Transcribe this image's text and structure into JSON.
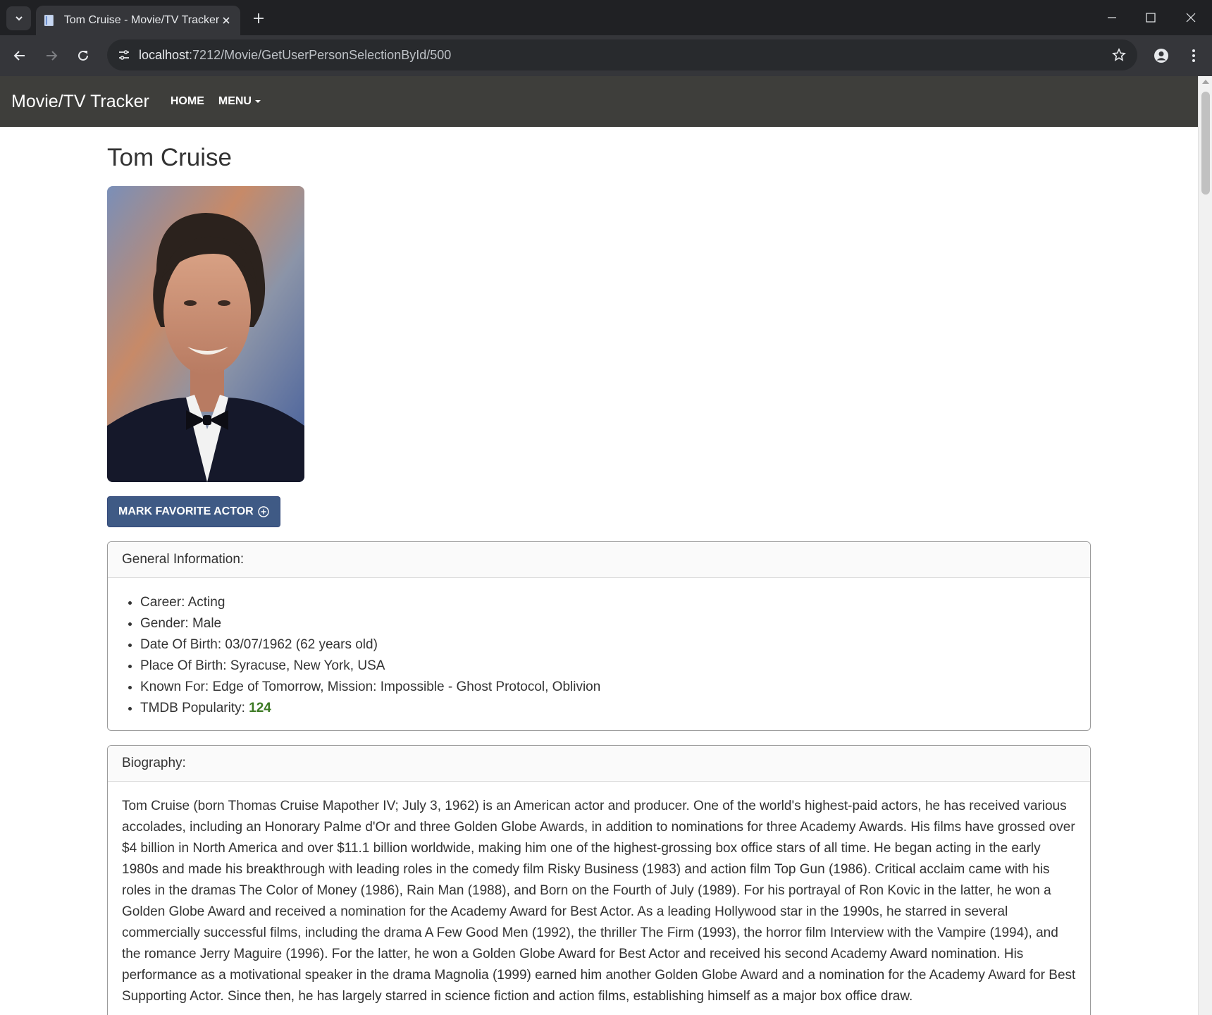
{
  "browser": {
    "tab_title": "Tom Cruise - Movie/TV Tracker",
    "url_host": "localhost",
    "url_rest": ":7212/Movie/GetUserPersonSelectionById/500"
  },
  "nav": {
    "brand": "Movie/TV Tracker",
    "home": "HOME",
    "menu": "MENU"
  },
  "person": {
    "name": "Tom Cruise",
    "photo_alt": "Tom Cruise",
    "favorite_button": "MARK FAVORITE ACTOR"
  },
  "general": {
    "header": "General Information:",
    "items": [
      {
        "label": "Career: ",
        "value": "Acting"
      },
      {
        "label": "Gender: ",
        "value": "Male"
      },
      {
        "label": "Date Of Birth: ",
        "value": "03/07/1962 (62 years old)"
      },
      {
        "label": "Place Of Birth: ",
        "value": "Syracuse, New York, USA"
      },
      {
        "label": "Known For: ",
        "value": "Edge of Tomorrow, Mission: Impossible - Ghost Protocol, Oblivion"
      }
    ],
    "popularity_label": "TMDB Popularity: ",
    "popularity_value": "124"
  },
  "biography": {
    "header": "Biography:",
    "text": "Tom Cruise (born Thomas Cruise Mapother IV; July 3, 1962) is an American actor and producer. One of the world's highest-paid actors, he has received various accolades, including an Honorary Palme d'Or and three Golden Globe Awards, in addition to nominations for three Academy Awards. His films have grossed over $4 billion in North America and over $11.1 billion worldwide, making him one of the highest-grossing box office stars of all time. He began acting in the early 1980s and made his breakthrough with leading roles in the comedy film Risky Business (1983) and action film Top Gun (1986). Critical acclaim came with his roles in the dramas The Color of Money (1986), Rain Man (1988), and Born on the Fourth of July (1989). For his portrayal of Ron Kovic in the latter, he won a Golden Globe Award and received a nomination for the Academy Award for Best Actor. As a leading Hollywood star in the 1990s, he starred in several commercially successful films, including the drama A Few Good Men (1992), the thriller The Firm (1993), the horror film Interview with the Vampire (1994), and the romance Jerry Maguire (1996). For the latter, he won a Golden Globe Award for Best Actor and received his second Academy Award nomination. His performance as a motivational speaker in the drama Magnolia (1999) earned him another Golden Globe Award and a nomination for the Academy Award for Best Supporting Actor. Since then, he has largely starred in science fiction and action films, establishing himself as a major box office draw."
  },
  "colors": {
    "navbar": "#3e3e3b",
    "button": "#3f5a85",
    "popularity": "#3d7a24"
  }
}
